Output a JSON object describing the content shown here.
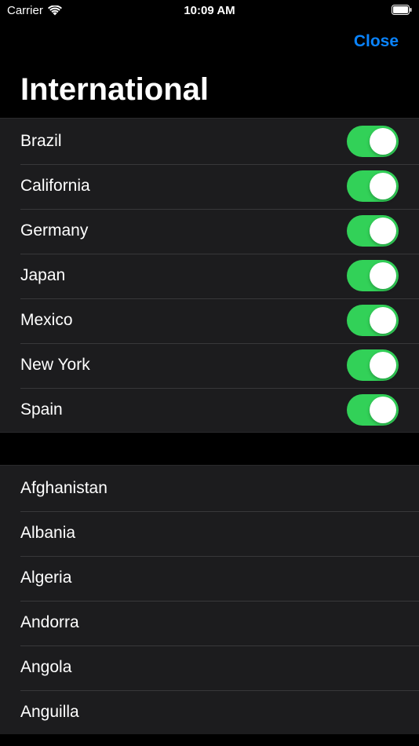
{
  "status_bar": {
    "carrier": "Carrier",
    "time": "10:09 AM"
  },
  "nav": {
    "close_label": "Close",
    "title": "International"
  },
  "colors": {
    "accent": "#0a84ff",
    "switch_on": "#32d158",
    "cell_background": "#1c1c1e",
    "background": "#000000"
  },
  "toggles": [
    {
      "label": "Brazil",
      "on": true
    },
    {
      "label": "California",
      "on": true
    },
    {
      "label": "Germany",
      "on": true
    },
    {
      "label": "Japan",
      "on": true
    },
    {
      "label": "Mexico",
      "on": true
    },
    {
      "label": "New York",
      "on": true
    },
    {
      "label": "Spain",
      "on": true
    }
  ],
  "countries": [
    "Afghanistan",
    "Albania",
    "Algeria",
    "Andorra",
    "Angola",
    "Anguilla"
  ]
}
